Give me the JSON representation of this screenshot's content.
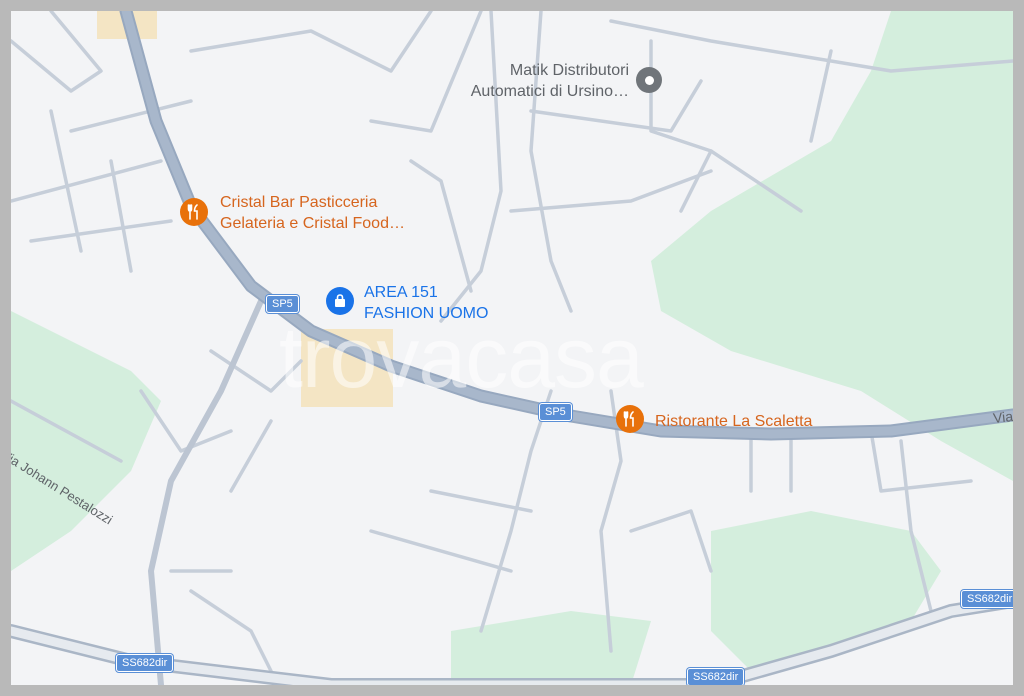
{
  "map": {
    "watermark": "trovacasa",
    "pois": [
      {
        "line1": "Cristal Bar Pasticceria",
        "line2": "Gelateria e Cristal Food…",
        "icon": "restaurant-icon",
        "color": "#e8710a"
      },
      {
        "line1": "AREA 151",
        "line2": "FASHION UOMO",
        "icon": "shopping-bag-icon",
        "color": "#1a73e8"
      },
      {
        "line1": "Matik Distributori",
        "line2": "Automatici di Ursino…",
        "icon": "place-icon",
        "color": "#70757a"
      },
      {
        "line1": "Ristorante La Scaletta",
        "icon": "restaurant-icon",
        "color": "#e8710a"
      }
    ],
    "road_shields": [
      "SP5",
      "SP5",
      "SS682dir",
      "SS682dir",
      "SS682dir"
    ],
    "streets": [
      "Via Johann Pestalozzi",
      "Via"
    ]
  }
}
